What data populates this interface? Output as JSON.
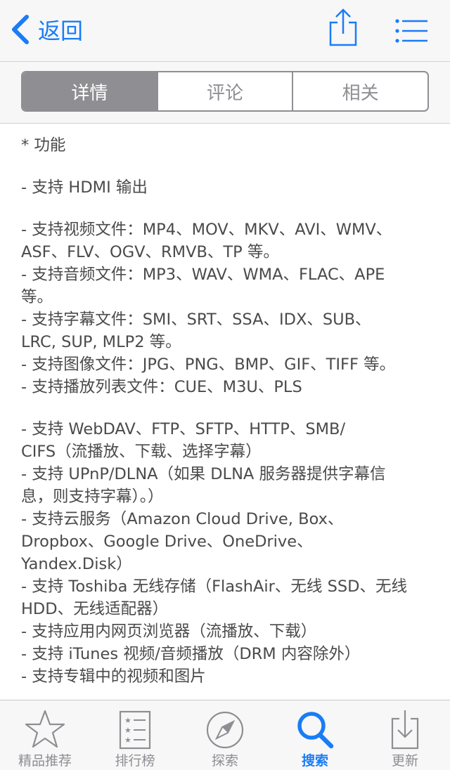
{
  "nav": {
    "back_label": "返回"
  },
  "segments": [
    {
      "label": "详情",
      "active": true
    },
    {
      "label": "评论",
      "active": false
    },
    {
      "label": "相关",
      "active": false
    }
  ],
  "description": [
    "* 功能",
    "",
    "- 支持 HDMI 输出",
    "",
    "- 支持视频文件：MP4、MOV、MKV、AVI、WMV、",
    "ASF、FLV、OGV、RMVB、TP 等。",
    "- 支持音频文件：MP3、WAV、WMA、FLAC、APE",
    "等。",
    "- 支持字幕文件：SMI、SRT、SSA、IDX、SUB、",
    "LRC, SUP, MLP2 等。",
    "- 支持图像文件：JPG、PNG、BMP、GIF、TIFF 等。",
    "- 支持播放列表文件：CUE、M3U、PLS",
    "",
    "- 支持 WebDAV、FTP、SFTP、HTTP、SMB/",
    "CIFS（流播放、下载、选择字幕）",
    "- 支持 UPnP/DLNA（如果 DLNA 服务器提供字幕信",
    "息，则支持字幕）。）",
    "- 支持云服务（Amazon Cloud Drive, Box、",
    "Dropbox、Google Drive、OneDrive、",
    "Yandex.Disk）",
    "- 支持 Toshiba 无线存储（FlashAir、无线 SSD、无线",
    "HDD、无线适配器）",
    "- 支持应用内网页浏览器（流播放、下载）",
    "- 支持 iTunes 视频/音频播放（DRM 内容除外）",
    "- 支持专辑中的视频和图片"
  ],
  "tabs": [
    {
      "label": "精品推荐",
      "icon": "star-icon",
      "active": false
    },
    {
      "label": "排行榜",
      "icon": "ranking-list-icon",
      "active": false
    },
    {
      "label": "探索",
      "icon": "compass-icon",
      "active": false
    },
    {
      "label": "搜索",
      "icon": "search-icon",
      "active": true
    },
    {
      "label": "更新",
      "icon": "download-tray-icon",
      "active": false
    }
  ],
  "colors": {
    "accent": "#1a7cf6",
    "inactive": "#8e8e93",
    "text": "#4a4a4a",
    "bar_background": "#f7f7f7"
  }
}
